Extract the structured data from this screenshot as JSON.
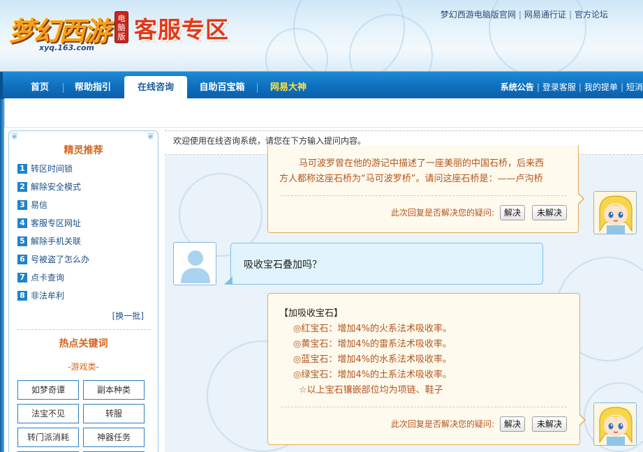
{
  "header": {
    "logo_text": "梦幻西游",
    "logo_badge": "电脑版",
    "logo_url": "xyq.163.com",
    "zone_title": "客服专区",
    "top_links": [
      "梦幻西游电脑版官网",
      "网易通行证",
      "官方论坛"
    ]
  },
  "nav": {
    "tabs": [
      "首页",
      "帮助指引",
      "在线咨询",
      "自助百宝箱",
      "网易大神"
    ],
    "active_tab": "在线咨询",
    "right_bold": "系统公告",
    "right_links": [
      "登录客服",
      "我的提单",
      "短消"
    ]
  },
  "sidebar": {
    "rec_title": "精灵推荐",
    "rec_items": [
      {
        "num": "1",
        "label": "转区时间锁"
      },
      {
        "num": "2",
        "label": "解除安全模式"
      },
      {
        "num": "3",
        "label": "易信"
      },
      {
        "num": "4",
        "label": "客服专区网址"
      },
      {
        "num": "5",
        "label": "解除手机关联"
      },
      {
        "num": "6",
        "label": "号被盗了怎么办"
      },
      {
        "num": "7",
        "label": "点卡查询"
      },
      {
        "num": "8",
        "label": "非法牟利"
      }
    ],
    "switch_batch": "[换一批]",
    "hot_title": "热点关键词",
    "hot_category": "-游戏类-",
    "keywords": [
      "如梦奇谭",
      "副本种类",
      "法宝不见",
      "转服",
      "转门派消耗",
      "神器任务"
    ]
  },
  "chat": {
    "welcome": "欢迎使用在线咨询系统，请您在下方输入提问内容。",
    "bot_reply_1": [
      "马可波罗曾在他的游记中描述了一座美丽的中国石桥，后来西",
      "方人都称这座石桥为“马可波罗桥”。请问这座石桥是：——卢沟桥"
    ],
    "resolve_question": "此次回复是否解决您的疑问:",
    "resolved_label": "解决",
    "unresolved_label": "未解决",
    "user_message": "吸收宝石叠加吗？",
    "bot_reply_2": [
      "【加吸收宝石】",
      "◎红宝石：增加4%的火系法术吸收率。",
      "◎黄宝石：增加4%的雷系法术吸收率。",
      "◎蓝宝石：增加4%的水系法术吸收率。",
      "◎绿宝石：增加4%的土系法术吸收率。",
      "☆以上宝石镶嵌部位均为项链、鞋子"
    ]
  },
  "colors": {
    "nav_blue": "#0f6fbd",
    "accent_orange": "#d2651f",
    "bot_text": "#b3541e",
    "zone_title_red": "#e2391b",
    "link_blue": "#1d4f86"
  }
}
